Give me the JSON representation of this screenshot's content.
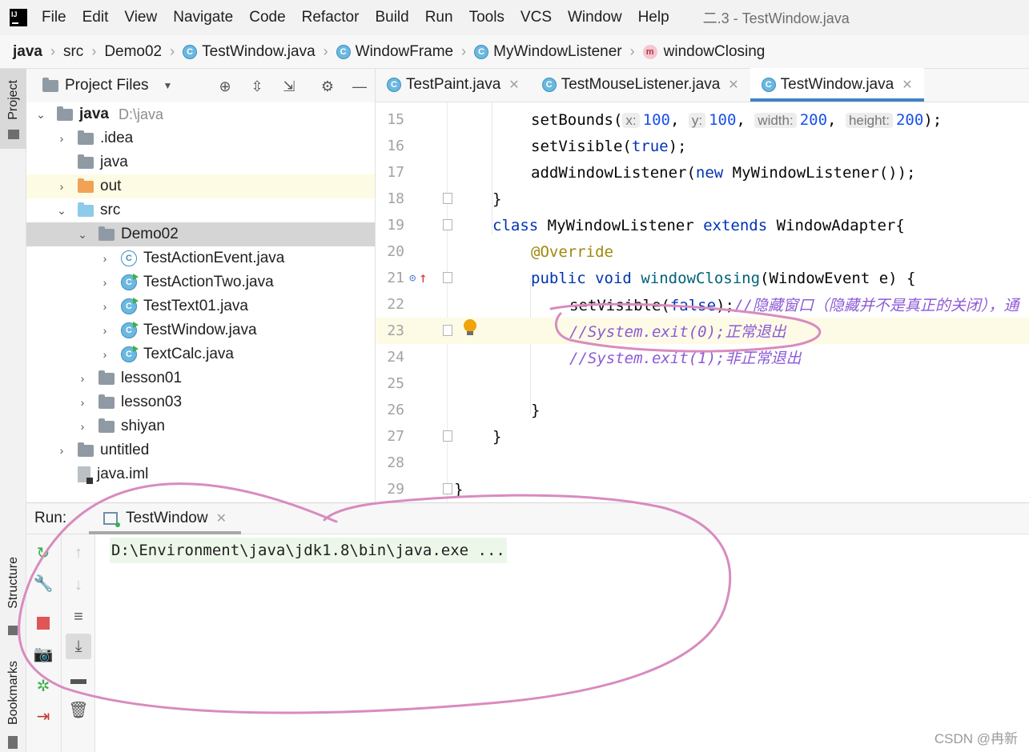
{
  "menu": {
    "items": [
      "File",
      "Edit",
      "View",
      "Navigate",
      "Code",
      "Refactor",
      "Build",
      "Run",
      "Tools",
      "VCS",
      "Window",
      "Help"
    ],
    "window_title": "二.3 - TestWindow.java"
  },
  "breadcrumb": {
    "items": [
      "java",
      "src",
      "Demo02",
      "TestWindow.java",
      "WindowFrame",
      "MyWindowListener",
      "windowClosing"
    ]
  },
  "left_strip": {
    "project": "Project",
    "structure": "Structure",
    "bookmarks": "Bookmarks"
  },
  "project_panel": {
    "title": "Project Files",
    "tree": [
      {
        "label": "java",
        "hint": "D:\\java",
        "expanded": true
      },
      {
        "label": ".idea"
      },
      {
        "label": "java"
      },
      {
        "label": "out"
      },
      {
        "label": "src",
        "expanded": true
      },
      {
        "label": "Demo02",
        "expanded": true
      },
      {
        "label": "TestActionEvent.java"
      },
      {
        "label": "TestActionTwo.java"
      },
      {
        "label": "TestText01.java"
      },
      {
        "label": "TestWindow.java"
      },
      {
        "label": "TextCalc.java"
      },
      {
        "label": "lesson01"
      },
      {
        "label": "lesson03"
      },
      {
        "label": "shiyan"
      },
      {
        "label": "untitled"
      },
      {
        "label": "java.iml"
      }
    ]
  },
  "editor": {
    "tabs": [
      "TestPaint.java",
      "TestMouseListener.java",
      "TestWindow.java"
    ],
    "active_tab": "TestWindow.java",
    "line_numbers": [
      "15",
      "16",
      "17",
      "18",
      "19",
      "20",
      "21",
      "22",
      "23",
      "24",
      "25",
      "26",
      "27",
      "28",
      "29"
    ],
    "code": {
      "l15": {
        "call": "setBounds(",
        "hx": "x:",
        "vx": "100",
        "hy": "y:",
        "vy": "100",
        "hw": "width:",
        "vw": "200",
        "hh": "height:",
        "vh": "200",
        "end": ");"
      },
      "l16": {
        "call": "setVisible(",
        "kw": "true",
        "end": ");"
      },
      "l17": {
        "call": "addWindowListener(",
        "kw": "new",
        "rest": " MyWindowListener());"
      },
      "l18": "}",
      "l19": {
        "kw1": "class",
        "name": " MyWindowListener ",
        "kw2": "extends",
        "rest": " WindowAdapter{"
      },
      "l20": "@Override",
      "l21": {
        "kw1": "public",
        "kw2": "void",
        "fn": "windowClosing",
        "rest": "(WindowEvent e) {"
      },
      "l22": {
        "call": "setVisible(",
        "kw": "false",
        "end": ");",
        "comment": "//隐藏窗口（隐藏并不是真正的关闭），通"
      },
      "l23": {
        "comment": "//System.exit(0);",
        "comment_cn": "正常退出"
      },
      "l24": {
        "comment": "//System.exit(1);",
        "comment_cn": "非正常退出"
      },
      "l26": "}",
      "l27": "}",
      "l29": "}"
    }
  },
  "run": {
    "label": "Run:",
    "tab": "TestWindow",
    "console_output": "D:\\Environment\\java\\jdk1.8\\bin\\java.exe ..."
  },
  "watermark": "CSDN @冉新",
  "colors": {
    "keyword": "#0033b3",
    "number": "#1750eb",
    "annotation": "#9e880d",
    "function": "#00627a",
    "comment": "#8c8c8c",
    "comment_cn": "#8c5bd6",
    "tab_underline": "#4083c9",
    "hand_drawn_circle": "#d98bbf",
    "stop_button": "#e05555",
    "rerun_green": "#3daf4a"
  },
  "icons": [
    "app-logo",
    "chevron-right-icon",
    "chevron-down-icon",
    "folder-icon",
    "java-class-icon",
    "method-icon",
    "locate-icon",
    "expand-all-icon",
    "collapse-all-icon",
    "gear-icon",
    "minimize-icon",
    "close-icon",
    "fold-icon",
    "bulb-icon",
    "implements-icon",
    "rerun-icon",
    "wrench-icon",
    "stop-icon",
    "camera-icon",
    "debug-icon",
    "exit-icon",
    "up-arrow-icon",
    "down-arrow-icon",
    "soft-wrap-icon",
    "scroll-to-end-icon",
    "print-icon",
    "trash-icon"
  ]
}
